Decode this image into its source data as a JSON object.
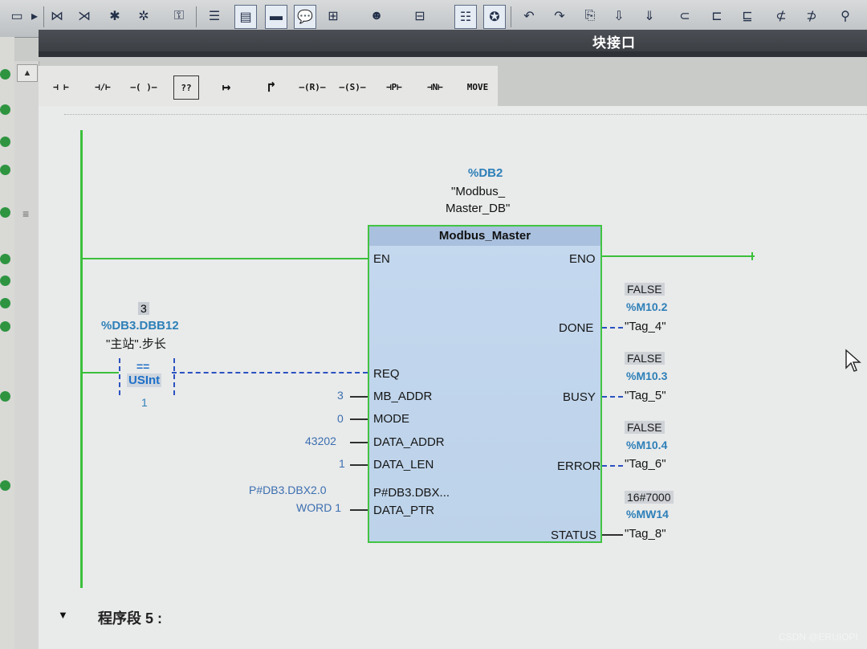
{
  "editor": {
    "title_bar": "块接口",
    "toolbar_icons": [
      "ladder-insert-icon",
      "ladder-delete-icon",
      "ladder-branch-icon",
      "ladder-close-icon",
      "user-key-icon",
      "list-view-icon",
      "window-icon",
      "fields-icon",
      "comment-icon",
      "absolute-addr-icon",
      "symbol-table-icon",
      "network-table-icon",
      "net-text-icon",
      "favorite-icon",
      "insert-network-icon",
      "delete-network-icon",
      "save-icon",
      "transfer-icon",
      "monitor-icon",
      "rung-insert-icon",
      "rung-move-icon",
      "rung-split-icon",
      "open-branch-icon",
      "close-branch-icon",
      "tag-icon"
    ]
  },
  "palette": {
    "items": [
      {
        "id": "no-contact",
        "label": "⊣ ⊢"
      },
      {
        "id": "nc-contact",
        "label": "⊣/⊢"
      },
      {
        "id": "coil",
        "label": "–( )–"
      },
      {
        "id": "empty-box",
        "label": "??"
      },
      {
        "id": "open-branch",
        "label": "↦"
      },
      {
        "id": "close-branch",
        "label": "↱"
      },
      {
        "id": "set",
        "label": "–(R)–"
      },
      {
        "id": "reset",
        "label": "–(S)–"
      },
      {
        "id": "p-trigger",
        "label": "⊣P⊢"
      },
      {
        "id": "n-trigger",
        "label": "⊣N⊢"
      },
      {
        "id": "move",
        "label": "MOVE"
      }
    ]
  },
  "compare": {
    "value": "3",
    "address": "%DB3.DBB12",
    "symbol": "\"主站\".步长",
    "operator": "==",
    "type": "USInt",
    "operand2": "1"
  },
  "fb": {
    "instance_db": "%DB2",
    "instance_sym1": "\"Modbus_",
    "instance_sym2": "Master_DB\"",
    "name": "Modbus_Master",
    "inputs": {
      "en": "EN",
      "req": "REQ",
      "mb_addr": {
        "pin": "MB_ADDR",
        "value": "3"
      },
      "mode": {
        "pin": "MODE",
        "value": "0"
      },
      "data_addr": {
        "pin": "DATA_ADDR",
        "value": "43202"
      },
      "data_len": {
        "pin": "DATA_LEN",
        "value": "1"
      },
      "data_ptr": {
        "pin": "DATA_PTR",
        "value_line1": "P#DB3.DBX2.0",
        "value_line2": "WORD 1",
        "monitor": "P#DB3.DBX..."
      }
    },
    "outputs": {
      "eno": "ENO",
      "done": {
        "pin": "DONE",
        "value": "FALSE",
        "address": "%M10.2",
        "tag": "\"Tag_4\""
      },
      "busy": {
        "pin": "BUSY",
        "value": "FALSE",
        "address": "%M10.3",
        "tag": "\"Tag_5\""
      },
      "error": {
        "pin": "ERROR",
        "value": "FALSE",
        "address": "%M10.4",
        "tag": "\"Tag_6\""
      },
      "status": {
        "pin": "STATUS",
        "value": "16#7000",
        "address": "%MW14",
        "tag": "\"Tag_8\""
      }
    }
  },
  "network": {
    "next_label": "程序段 5 :"
  },
  "watermark": "CSDN @ERUIOPI",
  "colors": {
    "energized": "#3cc03c",
    "not_energized": "#2a52c0",
    "address_blue": "#2d7fb8",
    "fb_fill": "#c0d5ec"
  }
}
